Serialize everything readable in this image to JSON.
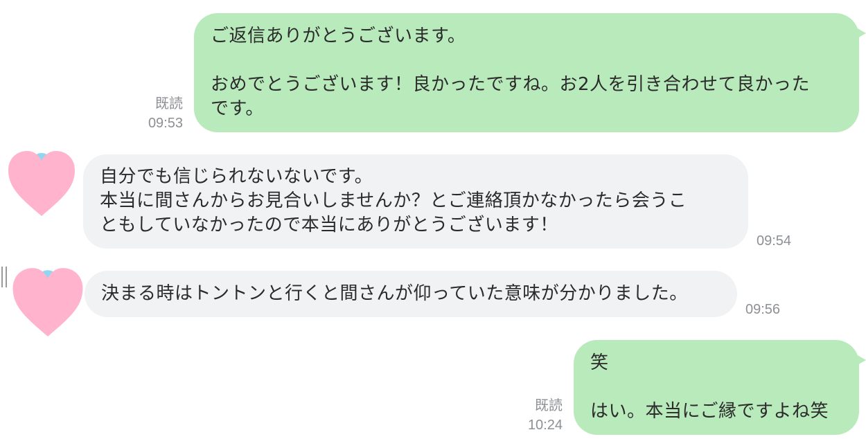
{
  "messages": [
    {
      "direction": "outgoing",
      "lines": [
        "ご返信ありがとうございます。",
        "",
        "おめでとうございます！良かったですね。お2人を引き合わせて良かった",
        "です。"
      ],
      "read_label": "既読",
      "time": "09:53"
    },
    {
      "direction": "incoming",
      "avatar": "heart-avatar",
      "lines": [
        "自分でも信じられないないです。",
        "本当に間さんからお見合いしませんか？とご連絡頂かなかったら会うこ",
        "ともしていなかったので本当にありがとうございます！"
      ],
      "time": "09:54"
    },
    {
      "direction": "incoming",
      "avatar": "heart-avatar",
      "lines": [
        "決まる時はトントンと行くと間さんが仰っていた意味が分かりました。"
      ],
      "time": "09:56"
    },
    {
      "direction": "outgoing",
      "lines": [
        "笑",
        "",
        "はい。本当にご縁ですよね笑"
      ],
      "read_label": "既読",
      "time": "10:24"
    }
  ],
  "colors": {
    "outgoing_bubble": "#b8eabb",
    "incoming_bubble": "#f1f2f4",
    "meta_text": "#8c8f94",
    "avatar_heart": "#ffb3cc",
    "avatar_accent": "#8fd6f2"
  }
}
